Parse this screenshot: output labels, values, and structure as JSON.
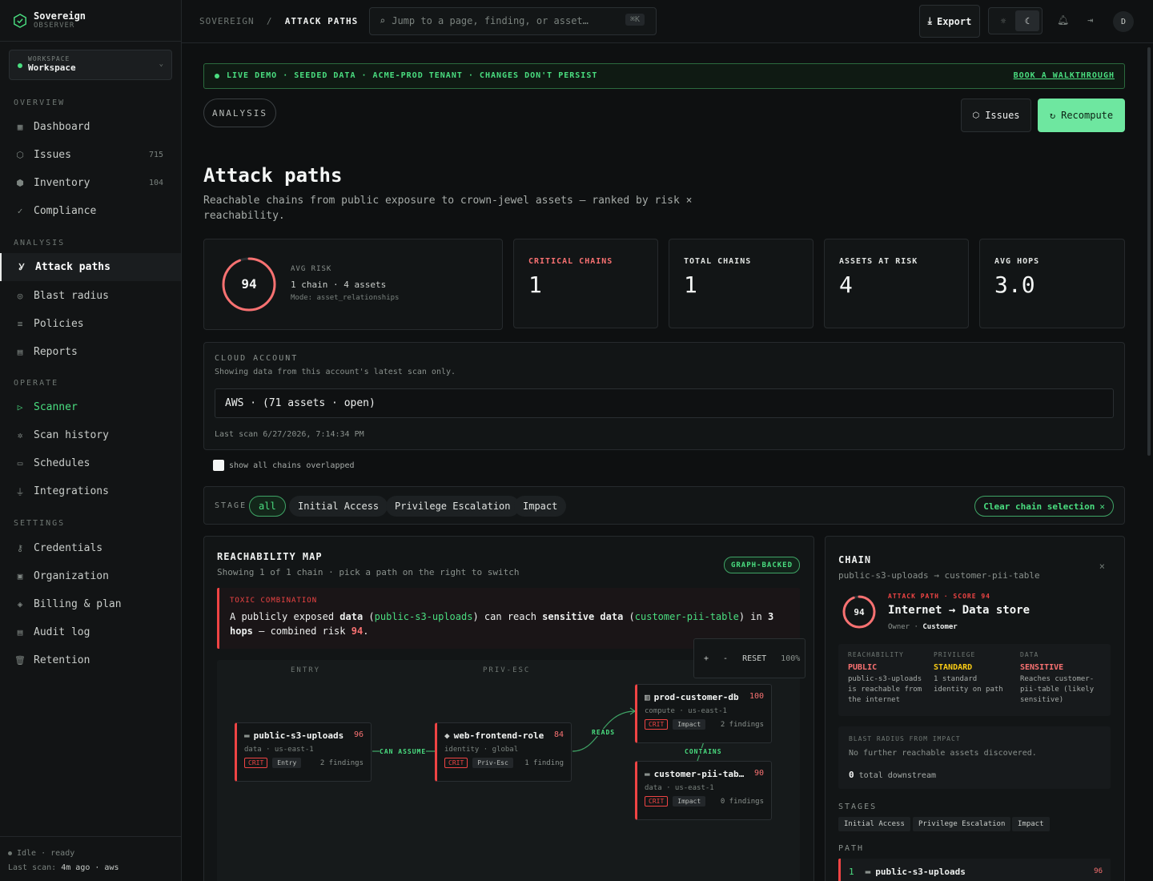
{
  "brand": {
    "name": "Sovereign",
    "tag": "OBSERVER"
  },
  "workspace": {
    "label": "WORKSPACE",
    "name": "Workspace"
  },
  "sidebar": {
    "sections": [
      {
        "title": "OVERVIEW",
        "items": [
          {
            "label": "Dashboard",
            "icon": "grid-icon"
          },
          {
            "label": "Issues",
            "icon": "shield-icon",
            "count": "715"
          },
          {
            "label": "Inventory",
            "icon": "box-icon",
            "count": "104"
          },
          {
            "label": "Compliance",
            "icon": "check-icon"
          }
        ]
      },
      {
        "title": "ANALYSIS",
        "items": [
          {
            "label": "Attack paths",
            "icon": "branch-icon",
            "active": true
          },
          {
            "label": "Blast radius",
            "icon": "radar-icon"
          },
          {
            "label": "Policies",
            "icon": "list-icon"
          },
          {
            "label": "Reports",
            "icon": "doc-icon"
          }
        ]
      },
      {
        "title": "OPERATE",
        "items": [
          {
            "label": "Scanner",
            "icon": "play-icon",
            "highlight": true
          },
          {
            "label": "Scan history",
            "icon": "history-icon"
          },
          {
            "label": "Schedules",
            "icon": "calendar-icon"
          },
          {
            "label": "Integrations",
            "icon": "plug-icon"
          }
        ]
      },
      {
        "title": "SETTINGS",
        "items": [
          {
            "label": "Credentials",
            "icon": "key-icon"
          },
          {
            "label": "Organization",
            "icon": "building-icon"
          },
          {
            "label": "Billing & plan",
            "icon": "layers-icon"
          },
          {
            "label": "Audit log",
            "icon": "doc-icon"
          },
          {
            "label": "Retention",
            "icon": "trash-icon"
          }
        ]
      }
    ],
    "footer": {
      "status": "Idle · ready",
      "last_scan_label": "Last scan:",
      "last_scan_value": "4m ago · aws"
    }
  },
  "topbar": {
    "crumb_root": "SOVEREIGN",
    "crumb_sep": "/",
    "crumb_current": "ATTACK PATHS",
    "search_placeholder": "Jump to a page, finding, or asset…",
    "search_kbd": "⌘K",
    "export_label": "Export",
    "avatar": "D"
  },
  "banner": {
    "text": "LIVE DEMO · SEEDED DATA · ACME-PROD TENANT · CHANGES DON'T PERSIST",
    "link": "BOOK A WALKTHROUGH"
  },
  "page": {
    "pill": "ANALYSIS",
    "issues_btn": "Issues",
    "recompute_btn": "Recompute",
    "title": "Attack paths",
    "subtitle": "Reachable chains from public exposure to crown-jewel assets — ranked by risk × reachability."
  },
  "summary": {
    "avg_risk_label": "AVG RISK",
    "avg_risk": 94,
    "avg_risk_fraction": 0.94,
    "chains_assets": "1 chain · 4 assets",
    "mode": "Mode: asset_relationships"
  },
  "stats": [
    {
      "label": "CRITICAL CHAINS",
      "value": "1",
      "color": "#f87171"
    },
    {
      "label": "TOTAL CHAINS",
      "value": "1"
    },
    {
      "label": "ASSETS AT RISK",
      "value": "4"
    },
    {
      "label": "AVG HOPS",
      "value": "3.0"
    }
  ],
  "cloud": {
    "label": "CLOUD ACCOUNT",
    "subtitle": "Showing data from this account's latest scan only.",
    "selected": "AWS · (71 assets · open)",
    "last_scan": "Last scan 6/27/2026, 7:14:34 PM"
  },
  "overlap_checkbox": "show all chains overlapped",
  "stage_filter": {
    "label": "STAGE",
    "chips": [
      "all",
      "Initial Access",
      "Privilege Escalation",
      "Impact"
    ],
    "active": "all",
    "clear": "Clear chain selection"
  },
  "map": {
    "title": "REACHABILITY MAP",
    "subtitle": "Showing 1 of 1 chain · pick a path on the right to switch",
    "badge": "GRAPH-BACKED",
    "toxic": {
      "label": "TOXIC COMBINATION",
      "p1": "A publicly exposed ",
      "b1": "data",
      "p2": " (",
      "g1": "public-s3-uploads",
      "p3": ") can reach ",
      "b2": "sensitive data",
      "p4": " (",
      "g2": "customer-pii-table",
      "p5": ") in ",
      "b3": "3 hops",
      "p6": " — combined risk ",
      "r1": "94",
      "p7": "."
    },
    "zoom": {
      "plus": "+",
      "minus": "-",
      "reset": "RESET",
      "pct": "100%"
    },
    "columns": [
      "ENTRY",
      "PRIV-ESC"
    ],
    "nodes": [
      {
        "name": "public-s3-uploads",
        "score": "96",
        "meta": "data · us-east-1",
        "sev": "CRIT",
        "stage": "Entry",
        "findings": "2 findings",
        "icon": "bucket-icon"
      },
      {
        "name": "web-frontend-role",
        "score": "84",
        "meta": "identity · global",
        "sev": "CRIT",
        "stage": "Priv-Esc",
        "findings": "1 finding",
        "icon": "diamond-icon"
      },
      {
        "name": "prod-customer-db",
        "score": "100",
        "meta": "compute · us-east-1",
        "sev": "CRIT",
        "stage": "Impact",
        "findings": "2 findings",
        "icon": "server-icon"
      },
      {
        "name": "customer-pii-tab…",
        "score": "90",
        "meta": "data · us-east-1",
        "sev": "CRIT",
        "stage": "Impact",
        "findings": "0 findings",
        "icon": "bucket-icon"
      }
    ],
    "edges": [
      "CAN ASSUME",
      "READS",
      "CONTAINS"
    ]
  },
  "chain": {
    "title": "CHAIN",
    "path": "public-s3-uploads → customer-pii-table",
    "close": "×",
    "score": 94,
    "score_fraction": 0.94,
    "kicker": "ATTACK PATH · SCORE 94",
    "headline": "Internet → Data store",
    "owner_label": "Owner ·",
    "owner": "Customer",
    "reach": {
      "label": "REACHABILITY",
      "value": "PUBLIC",
      "desc": "public-s3-uploads is reachable from the internet"
    },
    "priv": {
      "label": "PRIVILEGE",
      "value": "STANDARD",
      "desc": "1 standard identity on path"
    },
    "data": {
      "label": "DATA",
      "value": "SENSITIVE",
      "desc": "Reaches customer-pii-table (likely sensitive)"
    },
    "blast": {
      "label": "BLAST RADIUS FROM IMPACT",
      "msg": "No further reachable assets discovered.",
      "count": "0",
      "count_label": "total downstream"
    },
    "stages_label": "STAGES",
    "stages": [
      "Initial Access",
      "Privilege Escalation",
      "Impact"
    ],
    "path_label": "PATH",
    "path_rows": [
      {
        "idx": "1",
        "name": "public-s3-uploads",
        "score": "96"
      }
    ]
  },
  "colors": {
    "accent": "#4ade80",
    "critical": "#ef4444",
    "warning": "#facc15"
  }
}
